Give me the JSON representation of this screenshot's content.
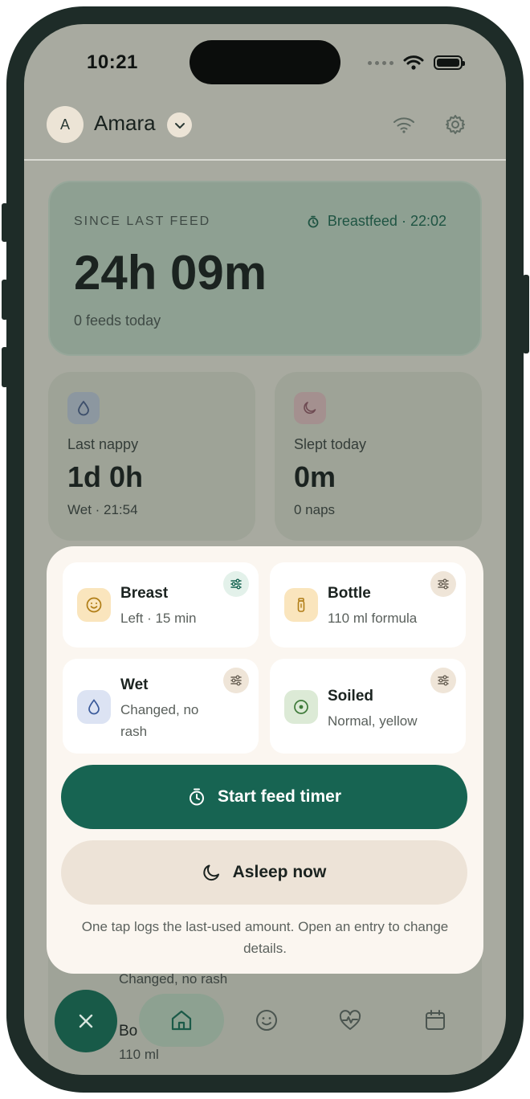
{
  "status_bar": {
    "time": "10:21"
  },
  "header": {
    "avatar_initial": "A",
    "profile_name": "Amara"
  },
  "feed_summary": {
    "label": "SINCE LAST FEED",
    "last_type": "Breastfeed · 22:02",
    "elapsed": "24h 09m",
    "count_today": "0 feeds today"
  },
  "nappy_card": {
    "label": "Last nappy",
    "value": "1d 0h",
    "sub": "Wet · 21:54"
  },
  "sleep_card": {
    "label": "Slept today",
    "value": "0m",
    "sub": "0 naps"
  },
  "background_list": {
    "row1_text": "Changed, no rash",
    "row2_title": "Bo",
    "row2_sub": "110 ml"
  },
  "quick_log": {
    "tiles": [
      {
        "title": "Breast",
        "sub": "Left · 15 min",
        "icon": "smile-icon"
      },
      {
        "title": "Bottle",
        "sub": "110 ml formula",
        "icon": "bottle-icon"
      },
      {
        "title": "Wet",
        "sub": "Changed, no rash",
        "icon": "droplet-icon"
      },
      {
        "title": "Soiled",
        "sub": "Normal, yellow",
        "icon": "target-icon"
      }
    ],
    "primary_label": "Start feed timer",
    "secondary_label": "Asleep now",
    "hint": "One tap logs the last-used amount. Open an entry to change details."
  },
  "nav": {
    "items": [
      "home-icon",
      "smile-icon",
      "heart-pulse-icon",
      "calendar-icon"
    ],
    "active": "home-icon"
  },
  "colors": {
    "accent": "#176452",
    "sheet_bg": "#fbf6f0",
    "secondary_bg": "#ede3d7"
  }
}
